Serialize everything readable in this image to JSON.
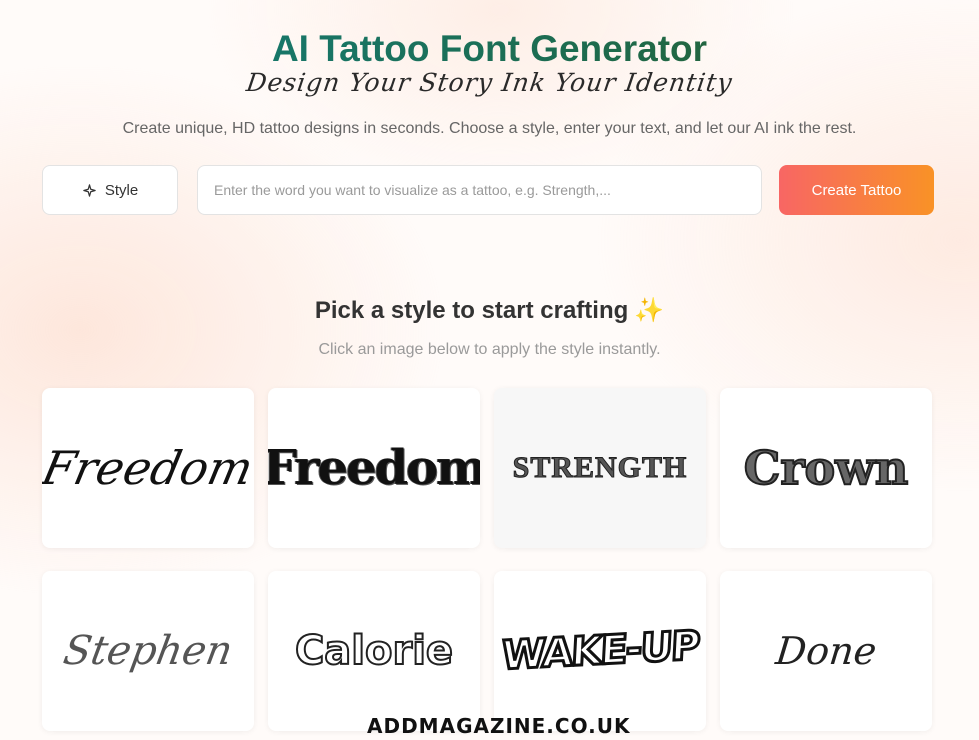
{
  "header": {
    "title": "AI Tattoo Font Generator",
    "tagline": "Design Your Story Ink Your Identity",
    "description": "Create unique, HD tattoo designs in seconds. Choose a style, enter your text, and let our AI ink the rest."
  },
  "form": {
    "style_button_label": "Style",
    "style_icon": "sparkle-outline-icon",
    "input_placeholder": "Enter the word you want to visualize as a tattoo, e.g. Strength,...",
    "input_value": "",
    "create_button_label": "Create Tattoo"
  },
  "styles_section": {
    "title": "Pick a style to start crafting",
    "title_emoji": "✨",
    "subtitle": "Click an image below to apply the style instantly."
  },
  "style_cards": [
    {
      "word": "Freedom"
    },
    {
      "word": "Freedom"
    },
    {
      "word": "STRENGTH"
    },
    {
      "word": "Crown"
    },
    {
      "word": "Stephen"
    },
    {
      "word": "Calorie"
    },
    {
      "word": "WAKE-UP"
    },
    {
      "word": "Done"
    }
  ],
  "watermark": "ADDMAGAZINE.CO.UK",
  "colors": {
    "title_gradient_start": "#12807f",
    "title_gradient_end": "#2d5a22",
    "create_button_start": "#f86664",
    "create_button_end": "#f99226"
  }
}
